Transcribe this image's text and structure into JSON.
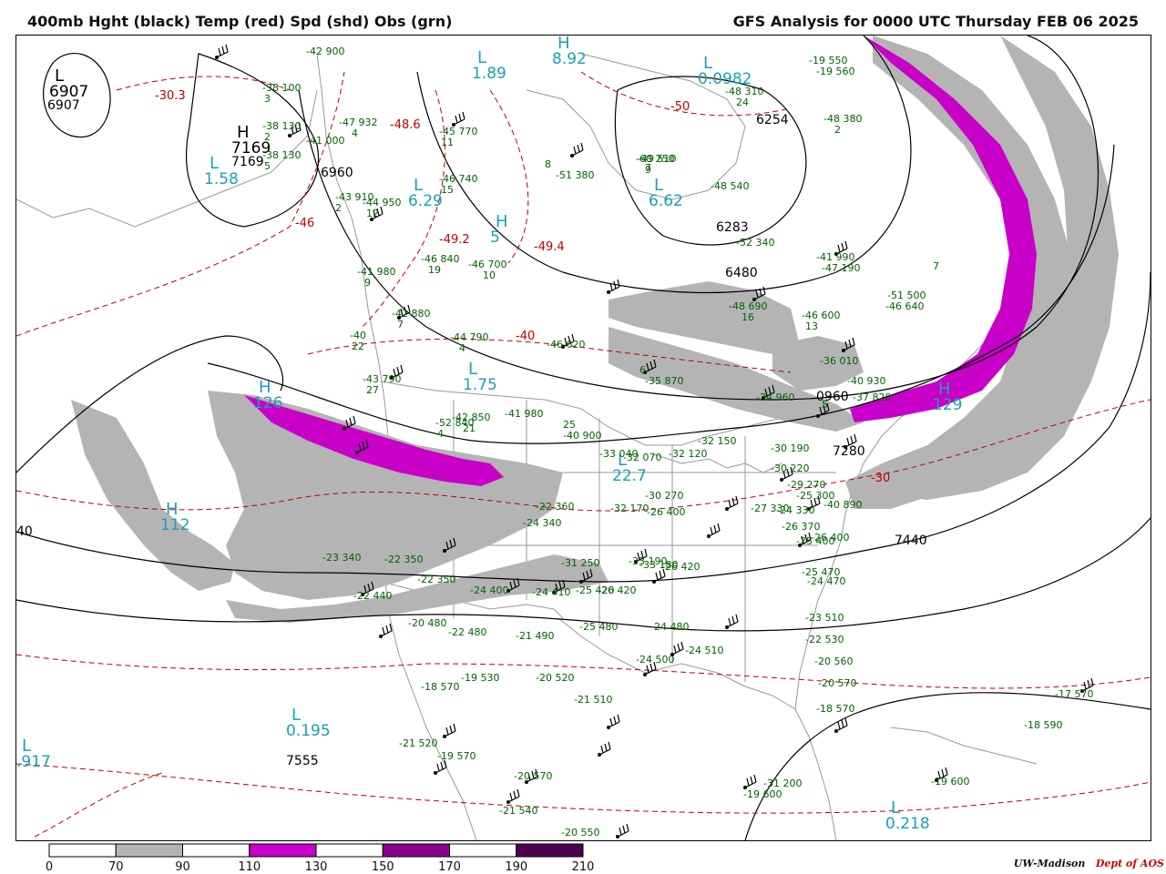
{
  "header": {
    "title_left": "400mb Hght (black) Temp (red) Spd (shd) Obs (grn)",
    "title_right": "GFS Analysis for 0000 UTC Thursday  FEB 06 2025"
  },
  "colors": {
    "height_contour": "#000000",
    "temp_contour": "#c00000",
    "speed_70_90": "#b4b4b4",
    "speed_110_130": "#c800c8",
    "speed_150_170": "#8c008c",
    "speed_190_210": "#500050",
    "obs": "#006400",
    "pressure_center": "#1aa0b4",
    "geography": "#999999"
  },
  "legend": {
    "ticks": [
      "0",
      "70",
      "90",
      "110",
      "130",
      "150",
      "170",
      "190",
      "210"
    ],
    "fills": [
      "#ffffff",
      "#b4b4b4",
      "#ffffff",
      "#c800c8",
      "#ffffff",
      "#8c008c",
      "#ffffff",
      "#500050"
    ]
  },
  "credit": {
    "org": "UW-Madison",
    "dept": "Dept of AOS"
  },
  "map_labels": {
    "height": [
      "6907",
      "7169",
      "6960",
      "6254",
      "6283",
      "6480",
      "0960",
      "7280",
      "7440",
      "7555",
      "40"
    ],
    "temperature": [
      "-30.3",
      "-48.6",
      "-46",
      "-49.2",
      "-49.4",
      "-50",
      "-40",
      "-30"
    ],
    "centers": [
      {
        "type": "H",
        "value": "7169",
        "color": "black"
      },
      {
        "type": "L",
        "value": "6907",
        "color": "black"
      },
      {
        "type": "L",
        "value": "1.89",
        "color": "cyan"
      },
      {
        "type": "L",
        "value": "1.58",
        "color": "cyan"
      },
      {
        "type": "L",
        "value": "0.0982",
        "color": "cyan"
      },
      {
        "type": "L",
        "value": "6.62",
        "color": "cyan"
      },
      {
        "type": "L",
        "value": "6.29",
        "color": "cyan"
      },
      {
        "type": "H",
        "value": "5",
        "color": "cyan"
      },
      {
        "type": "L",
        "value": "1.75",
        "color": "cyan"
      },
      {
        "type": "H",
        "value": "126",
        "color": "cyan"
      },
      {
        "type": "H",
        "value": "129",
        "color": "cyan"
      },
      {
        "type": "H",
        "value": "112",
        "color": "cyan"
      },
      {
        "type": "L",
        "value": "22.7",
        "color": "cyan"
      },
      {
        "type": "L",
        "value": "0.195",
        "color": "cyan"
      },
      {
        "type": "L",
        "value": ".917",
        "color": "cyan"
      },
      {
        "type": "L",
        "value": "0.218",
        "color": "cyan"
      },
      {
        "type": "H",
        "value": "8.92",
        "color": "cyan"
      }
    ],
    "obs": [
      "-38 100",
      "3",
      "-38 130",
      "2",
      "-38 130",
      "5",
      "-42 900",
      "-41 000",
      "-47 932",
      "4",
      "-43 910",
      "2",
      "-44 950",
      "12",
      "-41 980",
      "9",
      "-42 880",
      "7",
      "-40",
      "22",
      "-43 790",
      "27",
      "-45 770",
      "11",
      "-46 740",
      "15",
      "-46 840",
      "19",
      "-46 700",
      "10",
      "-44 790",
      "4",
      "-42 850",
      "21",
      "-41 980",
      "25",
      "-40 900",
      "-33 040",
      "-32 070",
      "-32 120",
      "-32 150",
      "-30 190",
      "-30 220",
      "-29 270",
      "-25 300",
      "-24 330",
      "-27 330",
      "-26 370",
      "-25 400",
      "-26 400",
      "-25 470",
      "-24 470",
      "-23 510",
      "-22 530",
      "-20 560",
      "-20 570",
      "-18 570",
      "-17 570",
      "-18 590",
      "-19 600",
      "-19 600",
      "-31 200",
      "-30 270",
      "-26 400",
      "-26 420",
      "-26 420",
      "-25 420",
      "-24 410",
      "-24 400",
      "-22 350",
      "-22 350",
      "-23 340",
      "-24 340",
      "-22 360",
      "-31 250",
      "-33 190",
      "-33 180",
      "-32 170",
      "-22 440",
      "-20 480",
      "-22 480",
      "-21 490",
      "-25 480",
      "-24 480",
      "-24 500",
      "-24 510",
      "-19 530",
      "-18 570",
      "-20 520",
      "-21 510",
      "-21 520",
      "-19 570",
      "-20 570",
      "-21 540",
      "-20 550",
      "-19 550",
      "-19 560",
      "-48 380",
      "2",
      "-48 310",
      "24",
      "-60 250",
      "9",
      "-52 340",
      "8",
      "-51 380",
      "-48 540",
      "7",
      "-51 500",
      "-46 640",
      "-46 600",
      "13",
      "-48 690",
      "16",
      "-46 620",
      "6",
      "-35 870",
      "-34 960",
      "5",
      "-36 010",
      "-40 930",
      "-37 820",
      "-40 890",
      "-41 990",
      "-47 190",
      "-49 510",
      "7",
      "-52 840",
      "4",
      "-44 650",
      "5"
    ]
  }
}
